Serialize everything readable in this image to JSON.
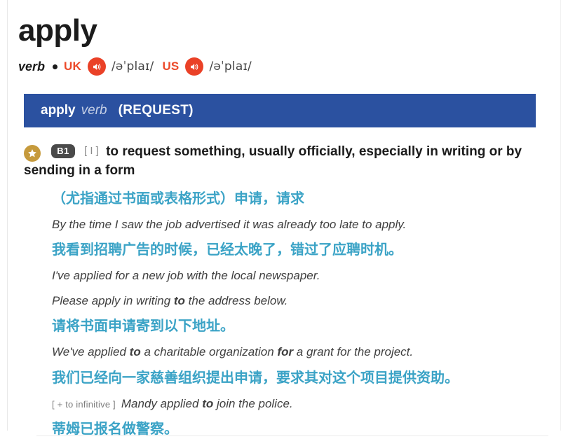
{
  "entry": {
    "headword": "apply",
    "part_of_speech": "verb",
    "pronunciations": [
      {
        "region": "UK",
        "speaker_icon": "speaker-icon",
        "ipa": "/əˈplaɪ/"
      },
      {
        "region": "US",
        "speaker_icon": "speaker-icon",
        "ipa": "/əˈplaɪ/"
      }
    ]
  },
  "sense_header": {
    "word": "apply",
    "pos": "verb",
    "guideword": "(REQUEST)"
  },
  "sense": {
    "star_icon": "star-icon",
    "level_badge": "B1",
    "grammar_label": "[ I ]",
    "definition": "to request something, usually officially, especially in writing or by sending in a form",
    "definition_zh": "（尤指通过书面或表格形式）申请，请求"
  },
  "examples": [
    {
      "text_before": "By the time I saw the job advertised it was already too late to apply.",
      "bold": "",
      "text_after": "",
      "grammar_label": "",
      "translation": "我看到招聘广告的时候，已经太晚了，错过了应聘时机。"
    },
    {
      "text_before": "I've applied for a new job with the local newspaper.",
      "bold": "",
      "text_after": "",
      "grammar_label": "",
      "translation": ""
    },
    {
      "text_before": "Please apply in writing ",
      "bold": "to",
      "text_after": " the address below.",
      "grammar_label": "",
      "translation": "请将书面申请寄到以下地址。"
    },
    {
      "text_before": "We've applied ",
      "bold": "to",
      "text_mid": " a charitable organization ",
      "bold2": "for",
      "text_after": " a grant for the project.",
      "grammar_label": "",
      "translation": "我们已经向一家慈善组织提出申请，要求其对这个项目提供资助。"
    },
    {
      "text_before": "Mandy applied ",
      "bold": "to",
      "text_after": " join the police.",
      "grammar_label": "[ + to infinitive ]",
      "translation": "蒂姆已报名做警察。"
    }
  ],
  "colors": {
    "sense_bar_blue": "#2b51a0",
    "speaker_red": "#ea4127",
    "region_red": "#ec4a2a",
    "star_gold": "#c69a3c",
    "badge_gray": "#4a4a4a",
    "chinese_teal": "#3ba3c6"
  }
}
